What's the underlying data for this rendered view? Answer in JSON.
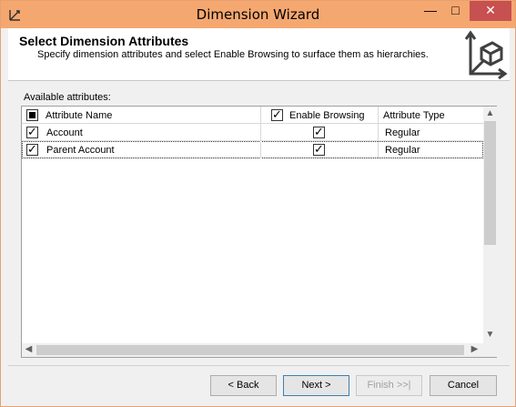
{
  "window": {
    "title": "Dimension Wizard",
    "minimize_glyph": "—",
    "maximize_glyph": "□",
    "close_glyph": "✕"
  },
  "header": {
    "title": "Select Dimension Attributes",
    "subtitle": "Specify dimension attributes and select Enable Browsing to surface them as hierarchies."
  },
  "attributes_label": "Available attributes:",
  "grid": {
    "columns": {
      "name": "Attribute Name",
      "browsing": "Enable Browsing",
      "type": "Attribute Type"
    },
    "rows": [
      {
        "name": "Account",
        "selected": true,
        "enable_browsing": true,
        "type": "Regular"
      },
      {
        "name": "Parent Account",
        "selected": true,
        "enable_browsing": true,
        "type": "Regular"
      }
    ]
  },
  "buttons": {
    "back": "< Back",
    "next": "Next >",
    "finish": "Finish >>|",
    "cancel": "Cancel"
  },
  "colors": {
    "titlebar": "#f5a770",
    "close_button": "#c75050"
  }
}
